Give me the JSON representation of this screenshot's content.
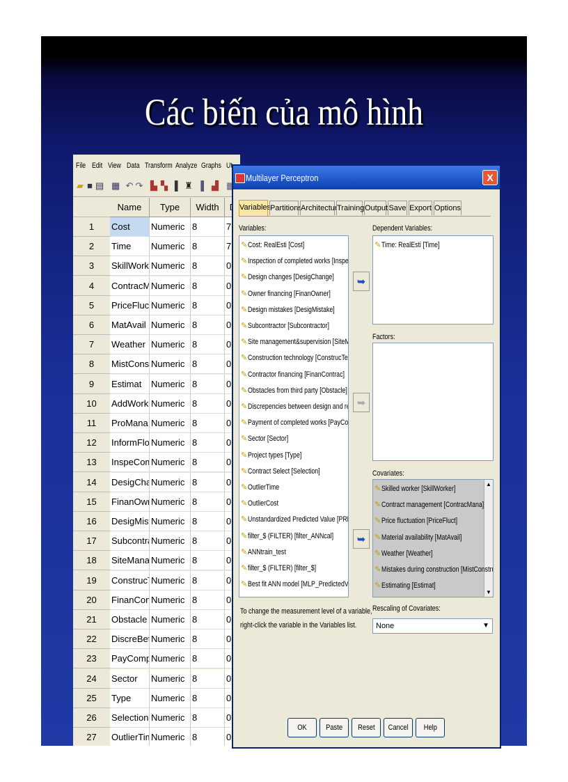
{
  "slide": {
    "title": "Các biến của mô hình"
  },
  "editor": {
    "menu": [
      "File",
      "Edit",
      "View",
      "Data",
      "Transform",
      "Analyze",
      "Graphs",
      "Ut"
    ],
    "columns": [
      "Name",
      "Type",
      "Width",
      "De"
    ],
    "rows": [
      {
        "n": "1",
        "name": "Cost",
        "type": "Numeric",
        "width": "8",
        "dec": "7"
      },
      {
        "n": "2",
        "name": "Time",
        "type": "Numeric",
        "width": "8",
        "dec": "7"
      },
      {
        "n": "3",
        "name": "SkillWorker",
        "type": "Numeric",
        "width": "8",
        "dec": "0"
      },
      {
        "n": "4",
        "name": "ContracMana",
        "type": "Numeric",
        "width": "8",
        "dec": "0"
      },
      {
        "n": "5",
        "name": "PriceFluct",
        "type": "Numeric",
        "width": "8",
        "dec": "0"
      },
      {
        "n": "6",
        "name": "MatAvail",
        "type": "Numeric",
        "width": "8",
        "dec": "0"
      },
      {
        "n": "7",
        "name": "Weather",
        "type": "Numeric",
        "width": "8",
        "dec": "0"
      },
      {
        "n": "8",
        "name": "MistConstruc",
        "type": "Numeric",
        "width": "8",
        "dec": "0"
      },
      {
        "n": "9",
        "name": "Estimat",
        "type": "Numeric",
        "width": "8",
        "dec": "0"
      },
      {
        "n": "10",
        "name": "AddWork",
        "type": "Numeric",
        "width": "8",
        "dec": "0"
      },
      {
        "n": "11",
        "name": "ProMana",
        "type": "Numeric",
        "width": "8",
        "dec": "0"
      },
      {
        "n": "12",
        "name": "InformFlow",
        "type": "Numeric",
        "width": "8",
        "dec": "0"
      },
      {
        "n": "13",
        "name": "InspeCompl...",
        "type": "Numeric",
        "width": "8",
        "dec": "0"
      },
      {
        "n": "14",
        "name": "DesigChange",
        "type": "Numeric",
        "width": "8",
        "dec": "0"
      },
      {
        "n": "15",
        "name": "FinanOwner",
        "type": "Numeric",
        "width": "8",
        "dec": "0"
      },
      {
        "n": "16",
        "name": "DesigMistake",
        "type": "Numeric",
        "width": "8",
        "dec": "0"
      },
      {
        "n": "17",
        "name": "Subcontractor",
        "type": "Numeric",
        "width": "8",
        "dec": "0"
      },
      {
        "n": "18",
        "name": "SiteManaSu...",
        "type": "Numeric",
        "width": "8",
        "dec": "0"
      },
      {
        "n": "19",
        "name": "ConstrucTe...",
        "type": "Numeric",
        "width": "8",
        "dec": "0"
      },
      {
        "n": "20",
        "name": "FinanContrac",
        "type": "Numeric",
        "width": "8",
        "dec": "0"
      },
      {
        "n": "21",
        "name": "Obstacle",
        "type": "Numeric",
        "width": "8",
        "dec": "0"
      },
      {
        "n": "22",
        "name": "DiscreBetD...",
        "type": "Numeric",
        "width": "8",
        "dec": "0"
      },
      {
        "n": "23",
        "name": "PayComplet...",
        "type": "Numeric",
        "width": "8",
        "dec": "0"
      },
      {
        "n": "24",
        "name": "Sector",
        "type": "Numeric",
        "width": "8",
        "dec": "0"
      },
      {
        "n": "25",
        "name": "Type",
        "type": "Numeric",
        "width": "8",
        "dec": "0"
      },
      {
        "n": "26",
        "name": "Selection",
        "type": "Numeric",
        "width": "8",
        "dec": "0"
      },
      {
        "n": "27",
        "name": "OutlierTime",
        "type": "Numeric",
        "width": "8",
        "dec": "0"
      }
    ]
  },
  "dialog": {
    "title": "Multilayer Perceptron",
    "close": "X",
    "tabs": [
      "Variables",
      "Partitions",
      "Architecture",
      "Training",
      "Output",
      "Save",
      "Export",
      "Options"
    ],
    "variables_label": "Variables:",
    "variables": [
      "Cost: RealEsti [Cost]",
      "Inspection of completed works [InspeCom...",
      "Design changes [DesigChange]",
      "Owner financing [FinanOwner]",
      "Design mistakes [DesigMistake]",
      "Subcontractor [Subcontractor]",
      "Site management&supervision [SiteManaS...",
      "Construction technology [ConstrucTechno]",
      "Contractor financing [FinanContrac]",
      "Obstacles from third party [Obstacle]",
      "Discrepencies between design and reality...",
      "Payment of completed works [PayComplet...",
      "Sector [Sector]",
      "Project types [Type]",
      "Contract Select [Selection]",
      "OutlierTime",
      "OutlierCost",
      "Unstandardized Predicted Value [PREDICT...",
      "filter_$ (FILTER) [filter_ANNcal]",
      "ANNtrain_test",
      "filter_$ (FILTER) [filter_$]",
      "Best fit ANN model [MLP_PredictedValue_A]"
    ],
    "dependent_label": "Dependent Variables:",
    "dependent": [
      "Time: RealEsti [Time]"
    ],
    "factors_label": "Factors:",
    "covariates_label": "Covariates:",
    "covariates": [
      "Skilled worker [SkillWorker]",
      "Contract management [ContracMana]",
      "Price fluctuation [PriceFluct]",
      "Material availability [MatAvail]",
      "Weather [Weather]",
      "Mistakes during construction [MistConstruc]",
      "Estimating [Estimat]"
    ],
    "note_line1": "To change the measurement level of a variable,",
    "note_line2": "right-click the variable in the Variables list.",
    "rescaling_label": "Rescaling of Covariates:",
    "rescaling_value": "None",
    "buttons": {
      "ok": "OK",
      "paste": "Paste",
      "reset": "Reset",
      "cancel": "Cancel",
      "help": "Help"
    }
  }
}
